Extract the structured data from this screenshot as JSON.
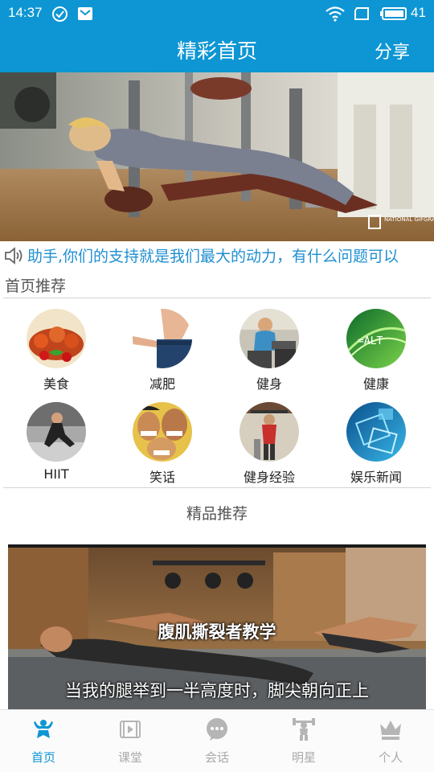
{
  "status": {
    "time": "14:37",
    "battery": "41"
  },
  "header": {
    "title": "精彩首页",
    "share": "分享"
  },
  "marquee": "助手,你们的支持就是我们最大的动力，有什么问题可以",
  "banner": {
    "watermark": "NATIONAL GIFGRAPHICS"
  },
  "recommend": {
    "heading": "首页推荐",
    "items": [
      {
        "label": "美食",
        "icon": "food-icon"
      },
      {
        "label": "减肥",
        "icon": "weight-loss-icon"
      },
      {
        "label": "健身",
        "icon": "fitness-icon"
      },
      {
        "label": "健康",
        "icon": "health-icon"
      },
      {
        "label": "HIIT",
        "icon": "hiit-icon"
      },
      {
        "label": "笑话",
        "icon": "joke-icon"
      },
      {
        "label": "健身经验",
        "icon": "fitness-experience-icon"
      },
      {
        "label": "娱乐新闻",
        "icon": "entertainment-news-icon"
      }
    ]
  },
  "premium": {
    "heading": "精品推荐",
    "video_title": "腹肌撕裂者教学",
    "video_subtitle": "当我的腿举到一半高度时，脚尖朝向正上"
  },
  "nav": {
    "tabs": [
      {
        "label": "首页",
        "icon": "home-icon",
        "active": true
      },
      {
        "label": "课堂",
        "icon": "class-icon",
        "active": false
      },
      {
        "label": "会话",
        "icon": "chat-icon",
        "active": false
      },
      {
        "label": "明星",
        "icon": "star-icon",
        "active": false
      },
      {
        "label": "个人",
        "icon": "profile-icon",
        "active": false
      }
    ]
  },
  "colors": {
    "primary": "#0d96d3",
    "marquee_text": "#1f8fd0"
  }
}
